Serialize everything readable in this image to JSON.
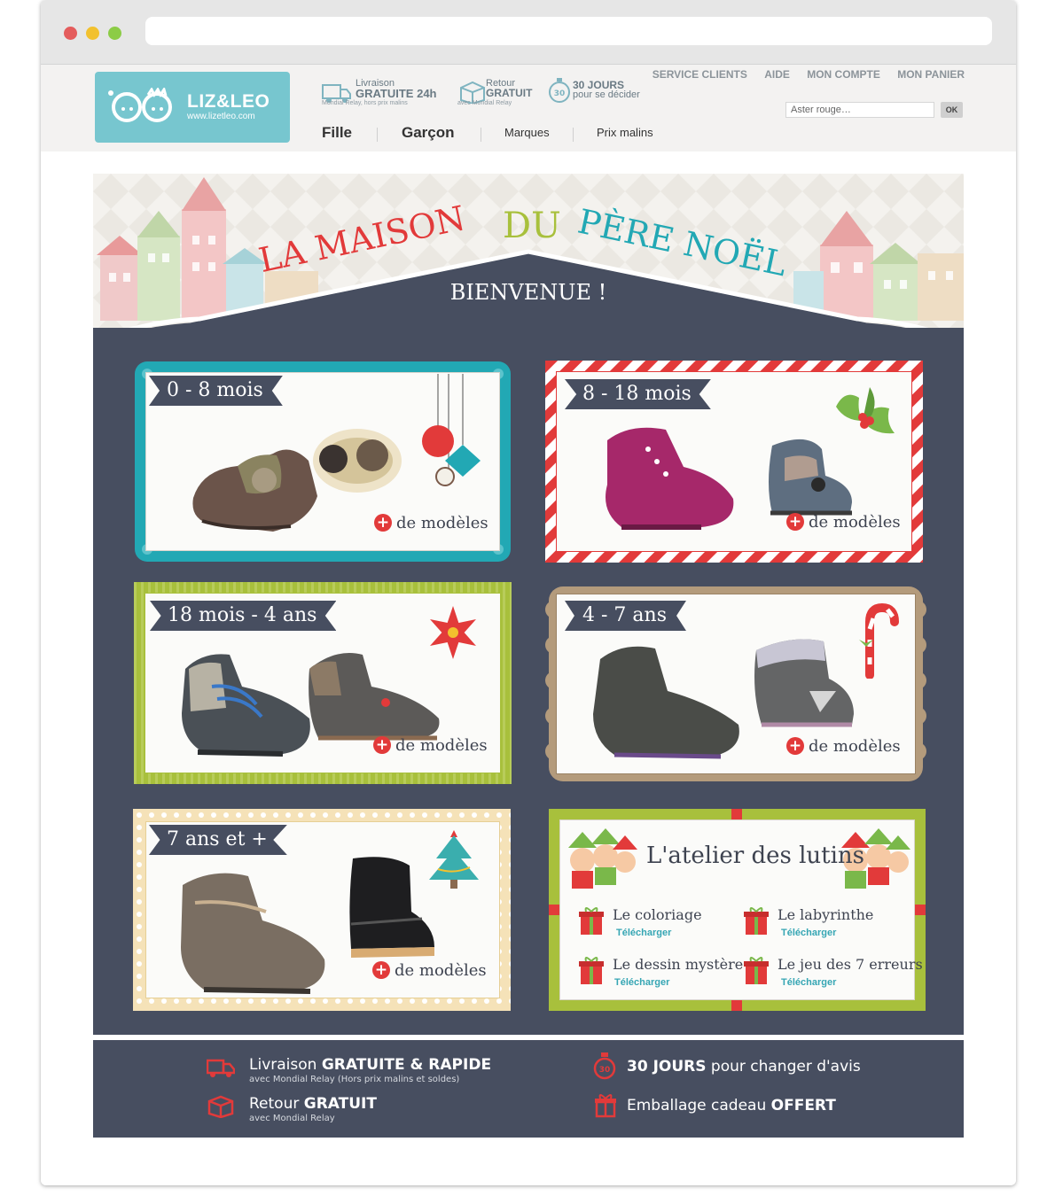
{
  "header": {
    "logo_brand": "LIZ&LEO",
    "logo_url": "www.lizetleo.com",
    "perks": [
      {
        "line1": "Livraison",
        "line2": "GRATUITE 24h",
        "sub": "Mondial Relay, hors prix malins"
      },
      {
        "line1": "Retour",
        "line2": "GRATUIT",
        "sub": "avec Mondial Relay"
      },
      {
        "line1": "30 JOURS",
        "line2": "pour se décider",
        "sub": ""
      }
    ],
    "top_links": [
      "SERVICE CLIENTS",
      "AIDE",
      "MON COMPTE",
      "MON PANIER"
    ],
    "search_value": "Aster rouge…",
    "search_button": "OK",
    "nav": [
      "Fille",
      "Garçon",
      "Marques",
      "Prix malins"
    ]
  },
  "banner": {
    "title_words": [
      "LA MAISON",
      "DU",
      "PÈRE NOËL"
    ],
    "subtitle": "BIENVENUE !"
  },
  "cards": [
    {
      "label": "0 - 8 mois",
      "more_prefix": "+",
      "more": "de modèles",
      "frame_color": "#22a8b4"
    },
    {
      "label": "8 - 18 mois",
      "more_prefix": "+",
      "more": "de modèles",
      "frame_color": "#e23a3a"
    },
    {
      "label": "18 mois - 4 ans",
      "more_prefix": "+",
      "more": "de modèles",
      "frame_color": "#a8c03c"
    },
    {
      "label": "4 - 7 ans",
      "more_prefix": "+",
      "more": "de modèles",
      "frame_color": "#b49b7c"
    },
    {
      "label": "7 ans et +",
      "more_prefix": "+",
      "more": "de modèles",
      "frame_color": "#f0d9a4"
    }
  ],
  "atelier": {
    "title": "L'atelier des lutins",
    "activities": [
      {
        "title": "Le coloriage",
        "action": "Télécharger"
      },
      {
        "title": "Le labyrinthe",
        "action": "Télécharger"
      },
      {
        "title": "Le dessin mystère",
        "action": "Télécharger"
      },
      {
        "title": "Le jeu des 7 erreurs",
        "action": "Télécharger"
      }
    ]
  },
  "footer": {
    "items": [
      {
        "pre": "Livraison ",
        "bold": "GRATUITE & RAPIDE",
        "post": "",
        "sub": "avec Mondial Relay (Hors prix malins et soldes)"
      },
      {
        "pre": "",
        "bold": "30 JOURS",
        "post": " pour changer d'avis",
        "sub": ""
      },
      {
        "pre": "Retour ",
        "bold": "GRATUIT",
        "post": "",
        "sub": "avec Mondial Relay"
      },
      {
        "pre": "Emballage cadeau ",
        "bold": "OFFERT",
        "post": "",
        "sub": ""
      }
    ]
  },
  "colors": {
    "board": "#474e60",
    "accent_red": "#e23a3a",
    "teal": "#22a8b4",
    "green": "#a8c03c"
  }
}
